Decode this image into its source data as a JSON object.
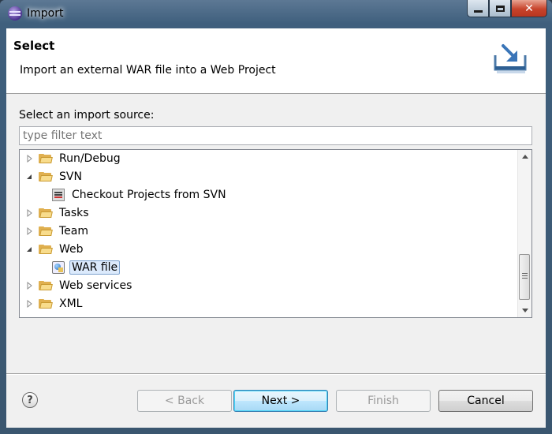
{
  "window": {
    "title": "Import"
  },
  "banner": {
    "title": "Select",
    "description": "Import an external WAR file into a Web Project",
    "icon": "import-wizard-icon"
  },
  "source": {
    "label": "Select an import source:",
    "filter_placeholder": "type filter text"
  },
  "tree": {
    "items": [
      {
        "label": "Run/Debug",
        "type": "folder",
        "expanded": false,
        "level": 0
      },
      {
        "label": "SVN",
        "type": "folder",
        "expanded": true,
        "level": 0
      },
      {
        "label": "Checkout Projects from SVN",
        "type": "svn-checkout",
        "level": 1
      },
      {
        "label": "Tasks",
        "type": "folder",
        "expanded": false,
        "level": 0
      },
      {
        "label": "Team",
        "type": "folder",
        "expanded": false,
        "level": 0
      },
      {
        "label": "Web",
        "type": "folder",
        "expanded": true,
        "level": 0
      },
      {
        "label": "WAR file",
        "type": "war-file",
        "level": 1,
        "selected": true
      },
      {
        "label": "Web services",
        "type": "folder",
        "expanded": false,
        "level": 0
      },
      {
        "label": "XML",
        "type": "folder",
        "expanded": false,
        "level": 0
      }
    ]
  },
  "buttons": {
    "help": "?",
    "back": "< Back",
    "next": "Next >",
    "finish": "Finish",
    "cancel": "Cancel"
  },
  "colors": {
    "selection": "#dceafc",
    "accent": "#3c7fb1"
  }
}
